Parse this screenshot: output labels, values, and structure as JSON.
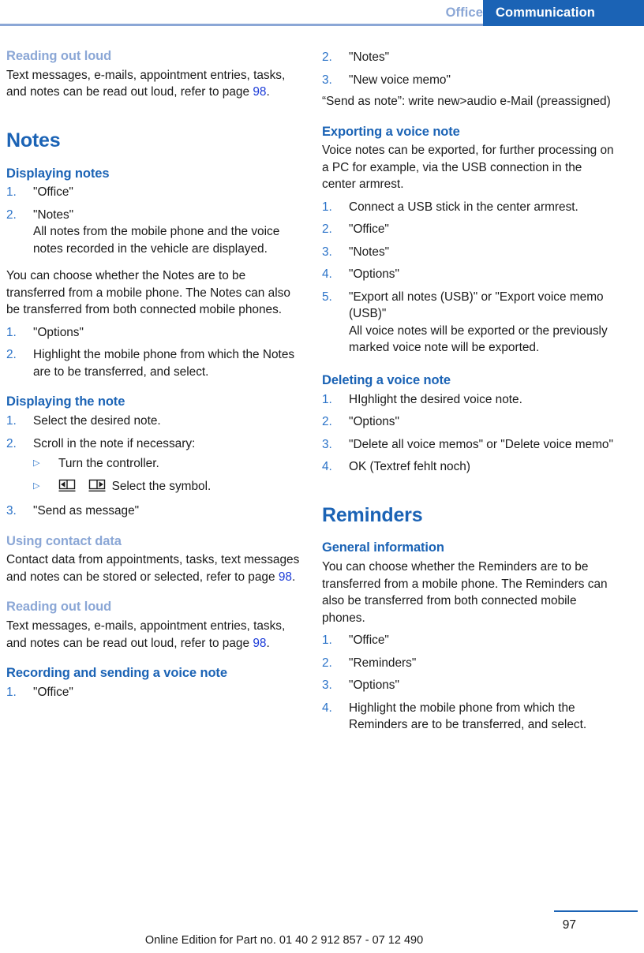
{
  "header": {
    "inactive_tab": "Office",
    "active_tab": "Communication",
    "accent_color": "#1b63b5",
    "muted_accent_color": "#8ba7d6"
  },
  "left_column": {
    "blocks": [
      {
        "heading": "Reading out loud",
        "heading_style": "muted",
        "paragraph_pre": "Text messages, e-mails, appointment entries, tasks, and notes can be read out loud, refer to page ",
        "paragraph_ref": "98",
        "paragraph_post": "."
      },
      {
        "chapter": "Notes"
      },
      {
        "heading": "Displaying notes",
        "heading_style": "normal",
        "steps": [
          {
            "num": "1.",
            "text": "\"Office\""
          },
          {
            "num": "2.",
            "text": "\"Notes\"",
            "note": "All notes from the mobile phone and the voice notes recorded in the vehicle are displayed."
          }
        ],
        "paragraph": "You can choose whether the Notes are to be transferred from a mobile phone. The Notes can also be transferred from both connected mobile phones.",
        "steps2": [
          {
            "num": "1.",
            "text": "\"Options\""
          },
          {
            "num": "2.",
            "text": "Highlight the mobile phone from which the Notes are to be transferred, and select."
          }
        ]
      },
      {
        "heading": "Displaying the note",
        "heading_style": "normal",
        "steps": [
          {
            "num": "1.",
            "text": "Select the desired note."
          },
          {
            "num": "2.",
            "text": "Scroll in the note if necessary:",
            "sub": [
              {
                "mark": "▷",
                "text": "Turn the controller."
              },
              {
                "mark": "▷",
                "text": "Select the symbol.",
                "icons": [
                  "book-prev-page-icon",
                  "book-next-page-icon"
                ]
              }
            ]
          },
          {
            "num": "3.",
            "text": "\"Send as message\""
          }
        ]
      },
      {
        "heading": "Using contact data",
        "heading_style": "muted",
        "paragraph_pre": "Contact data from appointments, tasks, text messages and notes can be stored or selected, refer to page ",
        "paragraph_ref": "98",
        "paragraph_post": "."
      },
      {
        "heading": "Reading out loud",
        "heading_style": "muted",
        "paragraph_pre": "Text messages, e-mails, appointment entries, tasks, and notes can be read out loud, refer to page ",
        "paragraph_ref": "98",
        "paragraph_post": "."
      },
      {
        "heading": "Recording and sending a voice note",
        "heading_style": "normal",
        "steps": [
          {
            "num": "1.",
            "text": "\"Office\""
          }
        ]
      }
    ]
  },
  "right_column": {
    "blocks": [
      {
        "steps_continued": [
          {
            "num": "2.",
            "text": "\"Notes\""
          },
          {
            "num": "3.",
            "text": "\"New voice memo\""
          }
        ],
        "paragraph": "“Send as note”: write new>audio e-Mail (preassigned)"
      },
      {
        "heading": "Exporting a voice note",
        "heading_style": "normal",
        "paragraph": "Voice notes can be exported, for further processing on a PC for example, via the USB connection in the center armrest.",
        "steps": [
          {
            "num": "1.",
            "text": "Connect a USB stick in the center armrest."
          },
          {
            "num": "2.",
            "text": "\"Office\""
          },
          {
            "num": "3.",
            "text": "\"Notes\""
          },
          {
            "num": "4.",
            "text": "\"Options\""
          },
          {
            "num": "5.",
            "text": "\"Export all notes (USB)\" or \"Export voice memo (USB)\"",
            "note": "All voice notes will be exported or the previously marked voice note will be exported."
          }
        ]
      },
      {
        "heading": "Deleting a voice note",
        "heading_style": "normal",
        "steps": [
          {
            "num": "1.",
            "text": "HIghlight the desired voice note."
          },
          {
            "num": "2.",
            "text": "\"Options\""
          },
          {
            "num": "3.",
            "text": "\"Delete all voice memos\" or \"Delete voice memo\""
          },
          {
            "num": "4.",
            "text": "OK (Textref fehlt noch)"
          }
        ]
      },
      {
        "chapter": "Reminders"
      },
      {
        "heading": "General information",
        "heading_style": "normal",
        "paragraph": "You can choose whether the Reminders are to be transferred from a mobile phone. The Reminders can also be transferred from both connected mobile phones.",
        "steps": [
          {
            "num": "1.",
            "text": "\"Office\""
          },
          {
            "num": "2.",
            "text": "\"Reminders\""
          },
          {
            "num": "3.",
            "text": "\"Options\""
          },
          {
            "num": "4.",
            "text": "Highlight the mobile phone from which the Reminders are to be transferred, and select."
          }
        ]
      }
    ]
  },
  "footer": {
    "note": "Online Edition for Part no. 01 40 2 912 857 - 07 12 490",
    "page_number": "97"
  }
}
